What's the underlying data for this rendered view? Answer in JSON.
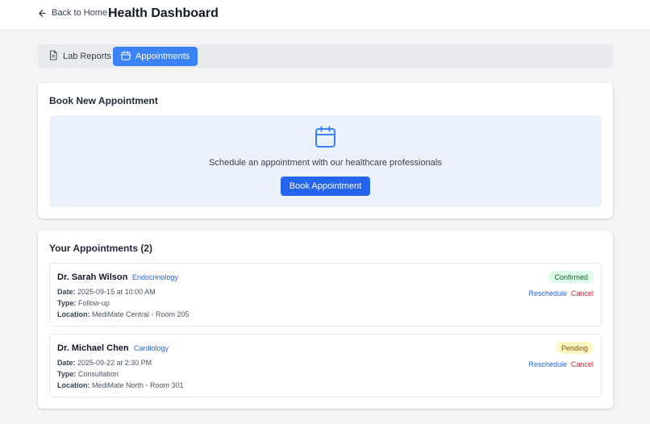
{
  "header": {
    "back_label": "Back to Home",
    "title": "Health Dashboard"
  },
  "tabs": [
    {
      "label": "Lab Reports",
      "icon": "document-icon",
      "active": false
    },
    {
      "label": "Appointments",
      "icon": "calendar-icon",
      "active": true
    }
  ],
  "book": {
    "title": "Book New Appointment",
    "description": "Schedule an appointment with our healthcare professionals",
    "button_label": "Book Appointment"
  },
  "appointments": {
    "title": "Your Appointments (2)",
    "items": [
      {
        "doctor": "Dr. Sarah Wilson",
        "specialty": "Endocrinology",
        "date_label": "Date:",
        "date": "2025-09-15 at 10:00 AM",
        "type_label": "Type:",
        "type": "Follow-up",
        "location_label": "Location:",
        "location": "MediMate Central - Room 205",
        "status": "Confirmed",
        "reschedule": "Reschedule",
        "cancel": "Cancel"
      },
      {
        "doctor": "Dr. Michael Chen",
        "specialty": "Cardiology",
        "date_label": "Date:",
        "date": "2025-09-22 at 2:30 PM",
        "type_label": "Type:",
        "type": "Consultation",
        "location_label": "Location:",
        "location": "MediMate North - Room 301",
        "status": "Pending",
        "reschedule": "Reschedule",
        "cancel": "Cancel"
      }
    ]
  },
  "colors": {
    "accent": "#3b82f6",
    "primary_button": "#2563eb",
    "confirmed_bg": "#dcfce7",
    "pending_bg": "#fef9c3",
    "cancel": "#dc2626"
  }
}
